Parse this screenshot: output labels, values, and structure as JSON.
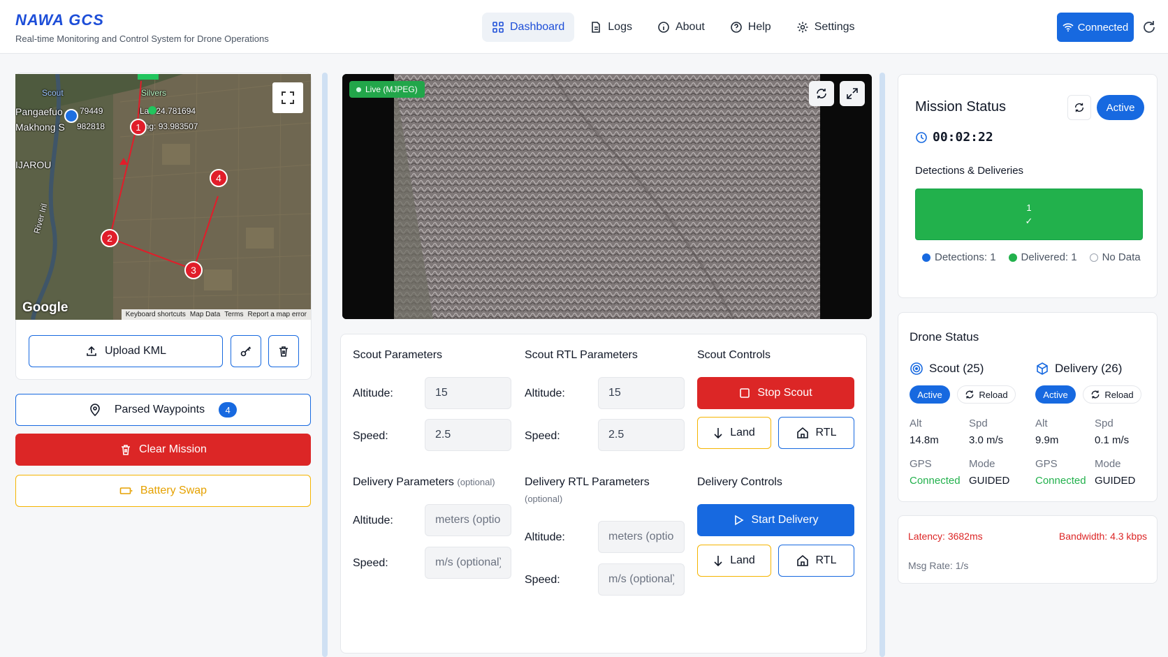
{
  "header": {
    "logo": "NAWA GCS",
    "subtitle": "Real-time Monitoring and Control System for Drone Operations",
    "nav": [
      {
        "label": "Dashboard",
        "icon": "dashboard-icon"
      },
      {
        "label": "Logs",
        "icon": "document-icon"
      },
      {
        "label": "About",
        "icon": "info-icon"
      },
      {
        "label": "Help",
        "icon": "help-icon"
      },
      {
        "label": "Settings",
        "icon": "gear-icon"
      }
    ],
    "connected_label": "Connected"
  },
  "map": {
    "labels": {
      "scout": "Scout",
      "silver": "Silvers",
      "town1": "Pangaefuo",
      "town2": "Makhong S",
      "coord1": "79449",
      "coord2": "982818",
      "coord3": "Lat: 24.781694",
      "coord4": "Lng: 93.983507",
      "region": "IJAROU",
      "river": "River Iril"
    },
    "markers": [
      "1",
      "2",
      "3",
      "4"
    ],
    "google": "Google",
    "attribution": [
      "Keyboard shortcuts",
      "Map Data",
      "Terms",
      "Report a map error"
    ]
  },
  "left_actions": {
    "upload_label": "Upload KML",
    "waypoints_label": "Parsed Waypoints",
    "waypoints_count": "4",
    "clear_label": "Clear Mission",
    "battery_label": "Battery Swap"
  },
  "video": {
    "live_label": "Live (MJPEG)"
  },
  "scout_params": {
    "title": "Scout Parameters",
    "altitude_label": "Altitude:",
    "altitude_value": "15",
    "speed_label": "Speed:",
    "speed_value": "2.5"
  },
  "scout_rtl": {
    "title": "Scout RTL Parameters",
    "altitude_label": "Altitude:",
    "altitude_value": "15",
    "speed_label": "Speed:",
    "speed_value": "2.5"
  },
  "scout_controls": {
    "title": "Scout Controls",
    "stop_label": "Stop Scout",
    "land_label": "Land",
    "rtl_label": "RTL"
  },
  "delivery_params": {
    "title": "Delivery Parameters",
    "optional": "(optional)",
    "altitude_label": "Altitude:",
    "altitude_placeholder": "meters (optional)",
    "speed_label": "Speed:",
    "speed_placeholder": "m/s (optional)"
  },
  "delivery_rtl": {
    "title": "Delivery RTL Parameters",
    "optional": "(optional)",
    "altitude_label": "Altitude:",
    "altitude_placeholder": "meters (optional)",
    "speed_label": "Speed:",
    "speed_placeholder": "m/s (optional)"
  },
  "delivery_controls": {
    "title": "Delivery Controls",
    "start_label": "Start Delivery",
    "land_label": "Land",
    "rtl_label": "RTL"
  },
  "mission": {
    "title": "Mission Status",
    "status": "Active",
    "timer": "00:02:22",
    "subtitle": "Detections & Deliveries",
    "bar_count": "1",
    "bar_check": "✓",
    "legend": {
      "detections": "Detections: 1",
      "delivered": "Delivered: 1",
      "nodata": "No Data"
    }
  },
  "drones": {
    "title": "Drone Status",
    "scout": {
      "name": "Scout (25)",
      "status": "Active",
      "reload": "Reload",
      "alt_label": "Alt",
      "alt_value": "14.8m",
      "spd_label": "Spd",
      "spd_value": "3.0 m/s",
      "gps_label": "GPS",
      "gps_value": "Connected",
      "mode_label": "Mode",
      "mode_value": "GUIDED"
    },
    "delivery": {
      "name": "Delivery (26)",
      "status": "Active",
      "reload": "Reload",
      "alt_label": "Alt",
      "alt_value": "9.9m",
      "spd_label": "Spd",
      "spd_value": "0.1 m/s",
      "gps_label": "GPS",
      "gps_value": "Connected",
      "mode_label": "Mode",
      "mode_value": "GUIDED"
    }
  },
  "network": {
    "latency": "Latency: 3682ms",
    "bandwidth": "Bandwidth: 4.3 kbps",
    "msg_rate": "Msg Rate: 1/s"
  },
  "colors": {
    "primary": "#1769e0",
    "danger": "#dc2626",
    "warning": "#f5b400",
    "success": "#22c55e"
  }
}
